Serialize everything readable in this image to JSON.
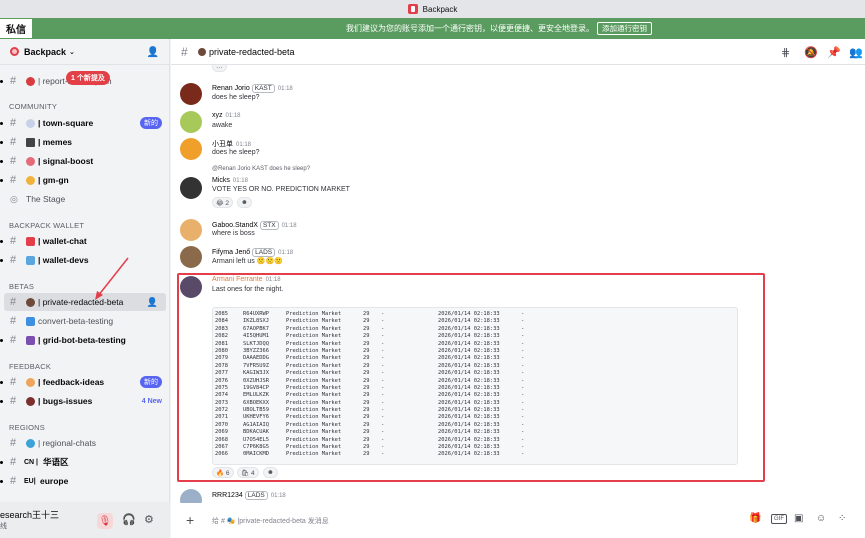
{
  "window": {
    "title": "Backpack"
  },
  "notice": {
    "dm_label": "私信",
    "message": "我们建议为您的账号添加一个通行密钥，以便更便捷、更安全地登录。",
    "button": "添加通行密钥"
  },
  "server": {
    "name": "Backpack"
  },
  "new_bubble": "1 个新提及",
  "sidebar": {
    "channels_top": [
      {
        "name": "| report-scam-spam",
        "color": "#d83c3e"
      }
    ],
    "categories": {
      "community": "COMMUNITY",
      "wallet": "BACKPACK WALLET",
      "betas": "BETAS",
      "feedback": "FEEDBACK",
      "regions": "REGIONS"
    },
    "community": [
      {
        "name": "| town-square",
        "badge": "新的",
        "color": "#c7d2e8"
      },
      {
        "name": "| memes",
        "color": "#444"
      },
      {
        "name": "| signal-boost",
        "color": "#e36b7a"
      },
      {
        "name": "| gm-gn",
        "color": "#f0b23a"
      },
      {
        "name": "The Stage",
        "color": "#80848e"
      }
    ],
    "wallet": [
      {
        "name": "| wallet-chat",
        "color": "#e33e4a"
      },
      {
        "name": "| wallet-devs",
        "color": "#5aa7e0"
      }
    ],
    "betas": [
      {
        "name": "| private-redacted-beta",
        "color": "#6e4a3a"
      },
      {
        "name": "convert-beta-testing",
        "color": "#3d8fe0"
      },
      {
        "name": "| grid-bot-beta-testing",
        "color": "#7a4fb0"
      }
    ],
    "feedback": [
      {
        "name": "| feedback-ideas",
        "badge": "新的",
        "color": "#f0a35a"
      },
      {
        "name": "| bugs-issues",
        "badge_text": "4 New",
        "color": "#7b3030"
      }
    ],
    "regions": [
      {
        "name": "| regional-chats",
        "color": "#3ca2d8"
      },
      {
        "name": "华语区",
        "prefix": "CN |"
      },
      {
        "name": "europe",
        "prefix": "EU|"
      }
    ]
  },
  "user_panel": {
    "name": "esearch王十三",
    "status": "线"
  },
  "chat": {
    "channel_name": "private-redacted-beta",
    "composer_placeholder": "给 # 🎭 |private-redacted-beta 发消息",
    "messages": [
      {
        "author": "Renan Jorio",
        "tag": "KAST",
        "time": "01:18",
        "text": "does he sleep?"
      },
      {
        "author": "xyz",
        "time": "01:18",
        "text": "awake"
      },
      {
        "author": "小丑单",
        "time": "01:18",
        "text": "does he sleep?"
      },
      {
        "reply": "@Renan Jorio  KAST  does he sleep?",
        "author": "Micks",
        "time": "01:18",
        "text": "VOTE YES OR NO. PREDICTION MARKET",
        "reactions": [
          "😂 2",
          "☻"
        ]
      },
      {
        "author": "Gaboo.StandX",
        "tag": "STX",
        "time": "01:18",
        "text": "where is boss"
      },
      {
        "author": "Fifyma Jenő",
        "tag": "LADS",
        "time": "01:18",
        "text": "Armani left us 🙁🙁🙁"
      },
      {
        "author": "Armani Ferrante",
        "time": "01:18",
        "text": "Last ones for the night.",
        "reactions": [
          "🔥 6",
          "🛍 4",
          "☻"
        ]
      },
      {
        "author": "RRR1234",
        "tag": "LADS",
        "time": "01:18"
      }
    ],
    "table_rows": [
      [
        "2085",
        "R64UXRWP",
        "Prediction Market",
        "29",
        "-",
        "2026/01/14 02:18:33",
        "-"
      ],
      [
        "2084",
        "IKZL8SXJ",
        "Prediction Market",
        "29",
        "-",
        "2026/01/14 02:18:33",
        "-"
      ],
      [
        "2083",
        "67AOPBK7",
        "Prediction Market",
        "29",
        "-",
        "2026/01/14 02:18:33",
        "-"
      ],
      [
        "2082",
        "4I5QHUM1",
        "Prediction Market",
        "29",
        "-",
        "2026/01/14 02:18:33",
        "-"
      ],
      [
        "2081",
        "SLKTJDQQ",
        "Prediction Market",
        "29",
        "-",
        "2026/01/14 02:18:33",
        "-"
      ],
      [
        "2080",
        "3BYZZ366",
        "Prediction Market",
        "29",
        "-",
        "2026/01/14 02:18:33",
        "-"
      ],
      [
        "2079",
        "DAAAEDDG",
        "Prediction Market",
        "29",
        "-",
        "2026/01/14 02:18:33",
        "-"
      ],
      [
        "2078",
        "7VFR5U9Z",
        "Prediction Market",
        "29",
        "-",
        "2026/01/14 02:18:33",
        "-"
      ],
      [
        "2077",
        "KAGIW3JX",
        "Prediction Market",
        "29",
        "-",
        "2026/01/14 02:18:33",
        "-"
      ],
      [
        "2076",
        "0XZUHJSR",
        "Prediction Market",
        "29",
        "-",
        "2026/01/14 02:18:33",
        "-"
      ],
      [
        "2075",
        "19GV84CP",
        "Prediction Market",
        "29",
        "-",
        "2026/01/14 02:18:33",
        "-"
      ],
      [
        "2074",
        "EMLULKZK",
        "Prediction Market",
        "29",
        "-",
        "2026/01/14 02:18:33",
        "-"
      ],
      [
        "2073",
        "6XBOEKXX",
        "Prediction Market",
        "29",
        "-",
        "2026/01/14 02:18:33",
        "-"
      ],
      [
        "2072",
        "UBOLTB59",
        "Prediction Market",
        "29",
        "-",
        "2026/01/14 02:18:33",
        "-"
      ],
      [
        "2071",
        "UKHEVFY6",
        "Prediction Market",
        "29",
        "-",
        "2026/01/14 02:18:33",
        "-"
      ],
      [
        "2070",
        "AG1AIAIQ",
        "Prediction Market",
        "29",
        "-",
        "2026/01/14 02:18:33",
        "-"
      ],
      [
        "2069",
        "BDKACUAK",
        "Prediction Market",
        "29",
        "-",
        "2026/01/14 02:18:33",
        "-"
      ],
      [
        "2068",
        "U7O54EL5",
        "Prediction Market",
        "29",
        "-",
        "2026/01/14 02:18:33",
        "-"
      ],
      [
        "2067",
        "C7P6K8G5",
        "Prediction Market",
        "29",
        "-",
        "2026/01/14 02:18:33",
        "-"
      ],
      [
        "2066",
        "0MAICKMD",
        "Prediction Market",
        "29",
        "-",
        "2026/01/14 02:18:33",
        "-"
      ]
    ]
  },
  "colors": {
    "accent": "#5865f2",
    "notice": "#5a9c5f",
    "highlight": "#e33e4a",
    "danger": "#da373c"
  }
}
